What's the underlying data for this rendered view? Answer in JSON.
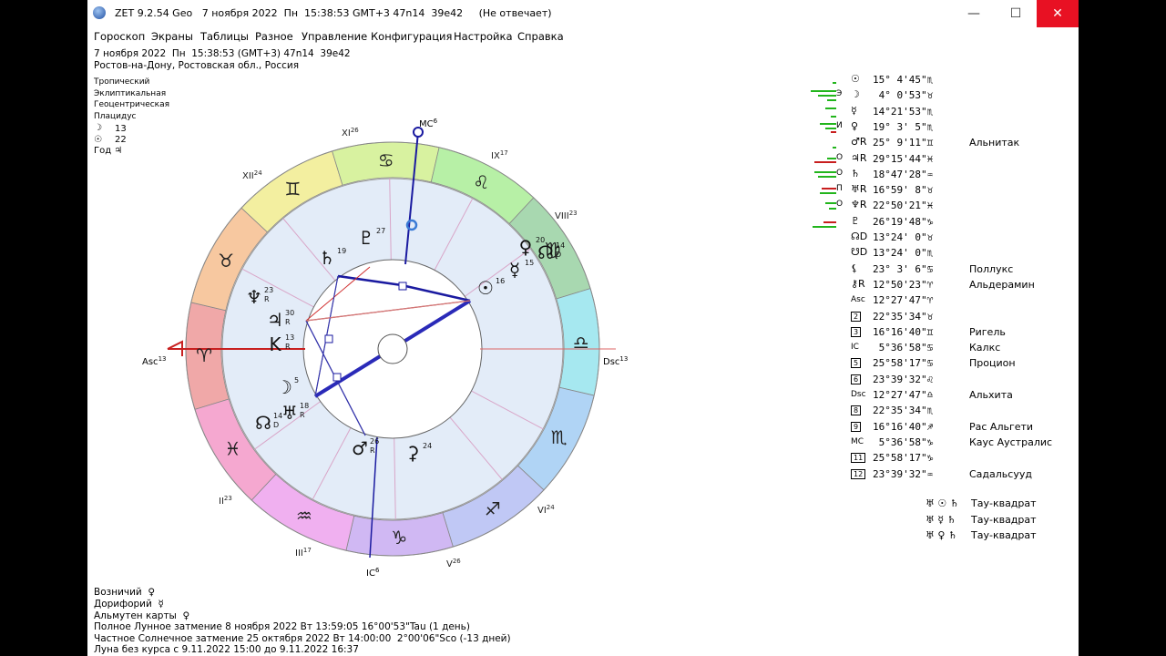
{
  "window": {
    "title": "ZET 9.2.54 Geo   7 ноября 2022  Пн  15:38:53 GMT+3 47n14  39e42     (Не отвечает)",
    "minimize": "—",
    "maximize": "☐",
    "close": "✕"
  },
  "menu": [
    "Гороскоп",
    "Экраны",
    "Таблицы",
    "Разное",
    "Управление",
    "Конфигурация",
    "Настройка",
    "Справка"
  ],
  "header": {
    "line1": "7 ноября 2022  Пн  15:38:53 (GMT+3) 47n14  39e42",
    "line2": "Ростов-на-Дону, Ростовская обл., Россия",
    "settings": [
      "Тропический",
      "Эклиптикальная",
      "Геоцентрическая",
      "Плацидус"
    ],
    "moon_num": "13",
    "sun_num": "22",
    "year_label": "Год ♃",
    "moon_glyph": "☽",
    "sun_glyph": "☉"
  },
  "chart": {
    "asc_label": "Asc",
    "asc_deg": "13",
    "dsc_label": "Dsc",
    "dsc_deg": "13",
    "mc_label": "MC",
    "mc_deg": "6",
    "ic_label": "IC",
    "ic_deg": "6",
    "houses": [
      {
        "label": "II",
        "deg": "23"
      },
      {
        "label": "III",
        "deg": "17"
      },
      {
        "label": "V",
        "deg": "26"
      },
      {
        "label": "VI",
        "deg": "24"
      },
      {
        "label": "VIII",
        "deg": "23"
      },
      {
        "label": "IX",
        "deg": "17"
      },
      {
        "label": "XI",
        "deg": "26"
      },
      {
        "label": "XII",
        "deg": "24"
      }
    ],
    "signs": [
      "♈",
      "♉",
      "♊",
      "♋",
      "♌",
      "♍",
      "♎",
      "♏",
      "♐",
      "♑",
      "♒",
      "♓"
    ],
    "planets": [
      {
        "glyph": "♄",
        "deg": "19",
        "r": ""
      },
      {
        "glyph": "♇",
        "deg": "27",
        "r": ""
      },
      {
        "glyph": "♀",
        "deg": "20",
        "r": ""
      },
      {
        "glyph": "☊",
        "deg": "14",
        "r": "D"
      },
      {
        "glyph": "☿",
        "deg": "15",
        "r": ""
      },
      {
        "glyph": "☉",
        "deg": "16",
        "r": ""
      },
      {
        "glyph": "♆",
        "deg": "23",
        "r": "R"
      },
      {
        "glyph": "♃",
        "deg": "30",
        "r": "R"
      },
      {
        "glyph": "K",
        "deg": "13",
        "r": "R"
      },
      {
        "glyph": "☽",
        "deg": "5",
        "r": ""
      },
      {
        "glyph": "☊",
        "deg": "14",
        "r": "D"
      },
      {
        "glyph": "♅",
        "deg": "18",
        "r": "R"
      },
      {
        "glyph": "♂",
        "deg": "26",
        "r": "R"
      },
      {
        "glyph": "⚳",
        "deg": "24",
        "r": ""
      }
    ]
  },
  "positions": [
    {
      "dig": "",
      "sym": "☉",
      "pos": "15° 4'45\"♏",
      "star": ""
    },
    {
      "dig": "Э",
      "sym": "☽",
      "pos": " 4° 0'53\"♉",
      "star": ""
    },
    {
      "dig": "",
      "sym": "☿",
      "pos": "14°21'53\"♏",
      "star": ""
    },
    {
      "dig": "И",
      "sym": "♀",
      "pos": "19° 3' 5\"♏",
      "star": ""
    },
    {
      "dig": "",
      "sym": "♂R",
      "pos": "25° 9'11\"♊",
      "star": "Альнитак"
    },
    {
      "dig": "О",
      "sym": "♃R",
      "pos": "29°15'44\"♓",
      "star": ""
    },
    {
      "dig": "О",
      "sym": "♄",
      "pos": "18°47'28\"♒",
      "star": ""
    },
    {
      "dig": "П",
      "sym": "♅R",
      "pos": "16°59' 8\"♉",
      "star": ""
    },
    {
      "dig": "О",
      "sym": "♆R",
      "pos": "22°50'21\"♓",
      "star": ""
    },
    {
      "dig": "",
      "sym": "♇",
      "pos": "26°19'48\"♑",
      "star": ""
    },
    {
      "dig": "",
      "sym": "☊D",
      "pos": "13°24' 0\"♉",
      "star": ""
    },
    {
      "dig": "",
      "sym": "☋D",
      "pos": "13°24' 0\"♏",
      "star": ""
    },
    {
      "dig": "",
      "sym": "⚸",
      "pos": "23° 3' 6\"♋",
      "star": "Поллукс"
    },
    {
      "dig": "",
      "sym": "⚷R",
      "pos": "12°50'23\"♈",
      "star": "Альдерамин"
    },
    {
      "dig": "",
      "sym": "Asc",
      "pos": "12°27'47\"♈",
      "star": ""
    },
    {
      "dig": "",
      "sym": "2",
      "pos": "22°35'34\"♉",
      "star": ""
    },
    {
      "dig": "",
      "sym": "3",
      "pos": "16°16'40\"♊",
      "star": "Ригель"
    },
    {
      "dig": "",
      "sym": "IC",
      "pos": " 5°36'58\"♋",
      "star": "Калкс"
    },
    {
      "dig": "",
      "sym": "5",
      "pos": "25°58'17\"♋",
      "star": "Процион"
    },
    {
      "dig": "",
      "sym": "6",
      "pos": "23°39'32\"♌",
      "star": ""
    },
    {
      "dig": "",
      "sym": "Dsc",
      "pos": "12°27'47\"♎",
      "star": "Альхита"
    },
    {
      "dig": "",
      "sym": "8",
      "pos": "22°35'34\"♏",
      "star": ""
    },
    {
      "dig": "",
      "sym": "9",
      "pos": "16°16'40\"♐",
      "star": "Рас Альгети"
    },
    {
      "dig": "",
      "sym": "MC",
      "pos": " 5°36'58\"♑",
      "star": "Каус Аустралис"
    },
    {
      "dig": "",
      "sym": "11",
      "pos": "25°58'17\"♑",
      "star": ""
    },
    {
      "dig": "",
      "sym": "12",
      "pos": "23°39'32\"♒",
      "star": "Садальсууд"
    }
  ],
  "aspects": [
    {
      "glyphs": "♅ ☉ ♄",
      "name": "Тау-квадрат"
    },
    {
      "glyphs": "♅ ☿ ♄",
      "name": "Тау-квадрат"
    },
    {
      "glyphs": "♅ ♀ ♄",
      "name": "Тау-квадрат"
    }
  ],
  "footer": [
    "Возничий  ♀",
    "Дорифорий  ☿",
    "Альмутен карты  ♀",
    "Полное Лунное затмение 8 ноября 2022 Вт 13:59:05 16°00'53\"Tau (1 день)",
    "Частное Солнечное затмение 25 октября 2022 Вт 14:00:00  2°00'06\"Sco (-13 дней)",
    "Луна без курса с 9.11.2022 15:00 до 9.11.2022 16:37"
  ],
  "colors": {
    "close": "#e81123",
    "aspect_blue": "#1a1aa0",
    "aspect_red": "#d03030",
    "green": "#22b51c",
    "red": "#c81e1e"
  }
}
